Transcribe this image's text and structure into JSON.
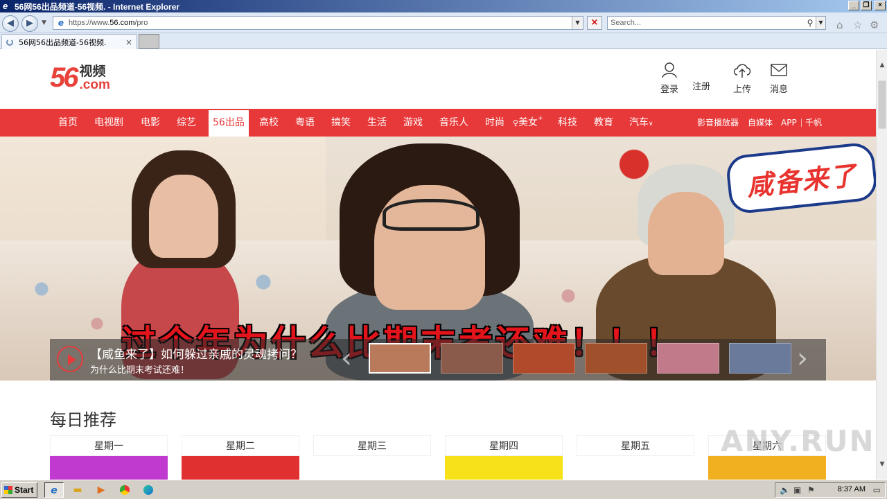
{
  "window": {
    "title": "56网56出品频道-56视频. - Internet Explorer",
    "buttons": {
      "minimize": "_",
      "restore": "❐",
      "close": "×"
    }
  },
  "browser": {
    "address_url_prefix": "https://www.",
    "address_url_domain": "56.com",
    "address_url_path": "/pro",
    "search_placeholder": "Search...",
    "tab_title": "56网56出品频道-56视频."
  },
  "site": {
    "logo_number": "56",
    "logo_cn": "视频",
    "logo_com": ".com",
    "header_actions": [
      {
        "label": "登录",
        "icon": "user-icon"
      },
      {
        "label": "注册",
        "icon": "register-icon"
      },
      {
        "label": "上传",
        "icon": "upload-cloud-icon"
      },
      {
        "label": "消息",
        "icon": "mail-icon"
      }
    ],
    "nav_items": [
      "首页",
      "电视剧",
      "电影",
      "综艺",
      "56出品",
      "高校",
      "粤语",
      "搞笑",
      "生活",
      "游戏",
      "音乐人",
      "时尚",
      "美女",
      "科技",
      "教育",
      "汽车"
    ],
    "nav_active": "56出品",
    "nav_beauty_sup": "+",
    "nav_car_caret": "∨",
    "nav_right": [
      "影音播放器",
      "自媒体",
      "APP",
      "千帆"
    ]
  },
  "banner": {
    "sticker_text": "咸备来了",
    "big_caption": "过个年为什么比期末考还难！！！",
    "title": "【咸鱼来了】如何躲过亲戚的灵魂拷问？",
    "subtitle": "为什么比期末考试还难！",
    "prev_arrow": "‹",
    "next_arrow": "›",
    "thumbnails": [
      {
        "color": "#b87a5a",
        "active": true
      },
      {
        "color": "#8a5a4a",
        "active": false
      },
      {
        "color": "#b04a2a",
        "active": false
      },
      {
        "color": "#a0502a",
        "active": false
      },
      {
        "color": "#c07a8a",
        "active": false
      },
      {
        "color": "#6a7a9a",
        "active": false
      }
    ]
  },
  "daily": {
    "heading": "每日推荐",
    "days": [
      {
        "label": "星期一",
        "color": "#c03ad0"
      },
      {
        "label": "星期二",
        "color": "#e03030"
      },
      {
        "label": "星期三",
        "color": "#ffffff"
      },
      {
        "label": "星期四",
        "color": "#f7e21a"
      },
      {
        "label": "星期五",
        "color": "#ffffff"
      },
      {
        "label": "星期六",
        "color": "#f0b020"
      }
    ]
  },
  "watermark": "ANY.RUN",
  "taskbar": {
    "start_label": "Start",
    "clock": "8:37 AM"
  },
  "colors": {
    "brand_red": "#e8393a",
    "titlebar": "#0a246a"
  }
}
